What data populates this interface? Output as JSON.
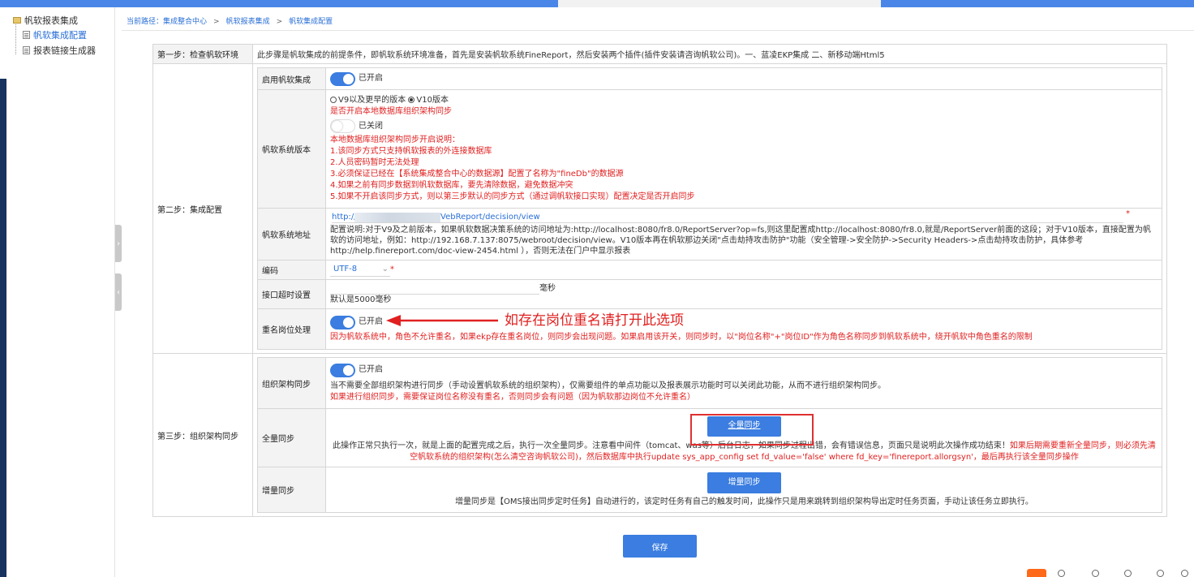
{
  "sidebar": {
    "root_label": "帆软报表集成",
    "items": [
      {
        "label": "帆软集成配置",
        "active": true
      },
      {
        "label": "报表链接生成器",
        "active": false
      }
    ]
  },
  "breadcrumb": {
    "prefix": "当前路径：集成整合中心",
    "item1": "帆软报表集成",
    "item2": "帆软集成配置",
    "sep": ">"
  },
  "step1": {
    "label": "第一步：检查帆软环境",
    "text": "此步骤是帆软集成的前提条件，即帆软系统环境准备，首先是安装帆软系统FineReport，然后安装两个插件(插件安装请咨询帆软公司)。一、蓝凌EKP集成 二、新移动端Html5"
  },
  "step2": {
    "label": "第二步：集成配置",
    "enable": {
      "label": "启用帆软集成",
      "status": "已开启"
    },
    "version": {
      "label": "帆软系统版本",
      "opt_v9": "V9以及更早的版本",
      "opt_v10": "V10版本",
      "local_sync_q": "是否开启本地数据库组织架构同步",
      "local_sync_status": "已关闭",
      "notes": [
        "本地数据库组织架构同步开启说明：",
        "1.该同步方式只支持帆软报表的外连接数据库",
        "2.人员密码暂时无法处理",
        "3.必须保证已经在【系统集成整合中心的数据源】配置了名称为\"fineDb\"的数据源",
        "4.如果之前有同步数据到帆软数据库，要先清除数据，避免数据冲突",
        "5.如果不开启该同步方式，则以第三步默认的同步方式（通过调帆软接口实现）配置决定是否开启同步"
      ]
    },
    "address": {
      "label": "帆软系统地址",
      "url_prefix": "http://",
      "url_suffix": "VebReport/decision/view",
      "required": "*",
      "desc": "配置说明:对于V9及之前版本，如果帆软数据决策系统的访问地址为:http://localhost:8080/fr8.0/ReportServer?op=fs,则这里配置成http://localhost:8080/fr8.0,就是/ReportServer前面的这段；对于V10版本，直接配置为帆软的访问地址，例如：http://192.168.7.137:8075/webroot/decision/view。V10版本再在帆软那边关闭\"点击劫持攻击防护\"功能（安全管理->安全防护->Security Headers->点击劫持攻击防护，具体参考http://help.finereport.com/doc-view-2454.html ），否则无法在门户中显示报表"
    },
    "encoding": {
      "label": "编码",
      "value": "UTF-8",
      "required": "*"
    },
    "timeout": {
      "label": "接口超时设置",
      "unit": "毫秒",
      "hint": "默认是5000毫秒"
    },
    "dup_post": {
      "label": "重名岗位处理",
      "status": "已开启",
      "note": "因为帆软系统中，角色不允许重名，如果ekp存在重名岗位，则同步会出现问题。如果启用该开关，则同步时，以\"岗位名称\"+\"岗位ID\"作为角色名称同步到帆软系统中，绕开帆软中角色重名的限制"
    }
  },
  "step3": {
    "label": "第三步：组织架构同步",
    "org_sync": {
      "label": "组织架构同步",
      "status": "已开启",
      "desc": "当不需要全部组织架构进行同步（手动设置帆软系统的组织架构），仅需要组件的单点功能以及报表展示功能时可以关闭此功能，从而不进行组织架构同步。",
      "warn": "如果进行组织同步，需要保证岗位名称没有重名，否则同步会有问题（因为帆软那边岗位不允许重名）"
    },
    "full_sync": {
      "label": "全量同步",
      "button": "全量同步",
      "desc": "此操作正常只执行一次，就是上面的配置完成之后，执行一次全量同步。注意看中间件（tomcat、was等）后台日志，如果同步过程出错，会有错误信息，页面只是说明此次操作成功结束！",
      "warn": "如果后期需要重新全量同步，则必须先清空帆软系统的组织架构(怎么清空咨询帆软公司)，然后数据库中执行update sys_app_config set fd_value='false' where fd_key='finereport.allorgsyn'，最后再执行该全量同步操作"
    },
    "inc_sync": {
      "label": "增量同步",
      "button": "增量同步",
      "desc": "增量同步是【OMS接出同步定时任务】自动进行的，该定时任务有自己的触发时间，此操作只是用来跳转到组织架构导出定时任务页面，手动让该任务立即执行。"
    }
  },
  "annotation": {
    "text": "如存在岗位重名请打开此选项",
    "color": "#e02020"
  },
  "save_button": "保存",
  "colors": {
    "accent": "#3b7de0",
    "warning": "#e02020",
    "nav_dark": "#17335e"
  }
}
